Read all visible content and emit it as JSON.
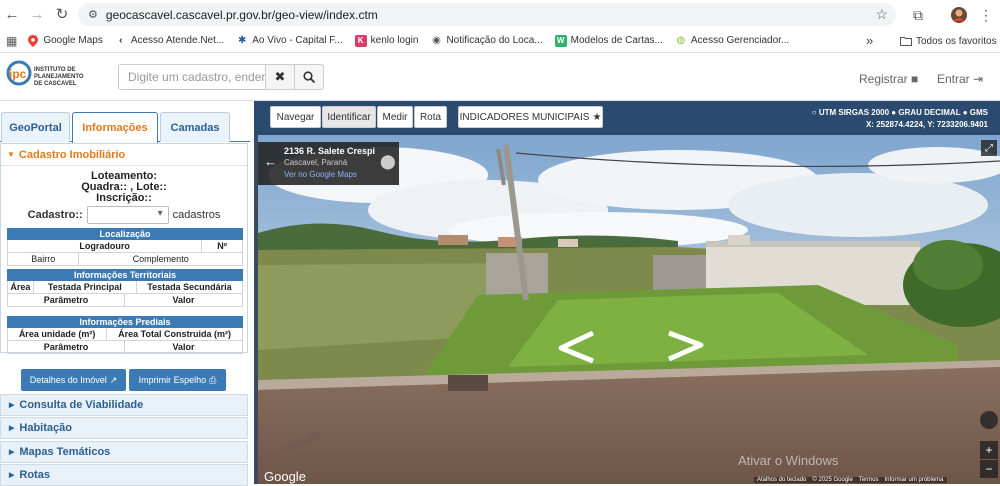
{
  "browser": {
    "url": "geocascavel.cascavel.pr.gov.br/geo-view/index.ctm",
    "bookmarks": [
      {
        "label": "Google Maps",
        "icon": "maps-pin-icon",
        "color": "#e94235"
      },
      {
        "label": "Acesso Atende.Net...",
        "icon": "chevron-left-icon",
        "color": "#444444"
      },
      {
        "label": "Ao Vivo - Capital F...",
        "icon": "paw-icon",
        "color": "#1e5aa8"
      },
      {
        "label": "kenlo login",
        "icon": "kenlo-icon",
        "color": "#d93b6a"
      },
      {
        "label": "Notificação do Loca...",
        "icon": "globe-icon",
        "color": "#555555"
      },
      {
        "label": "Modelos de Cartas...",
        "icon": "w-icon",
        "color": "#2fb36b"
      },
      {
        "label": "Acesso Gerenciador...",
        "icon": "leaf-icon",
        "color": "#8bbf2f"
      }
    ],
    "more_label": "»",
    "all_bookmarks_label": "Todos os favoritos"
  },
  "header": {
    "logo_text_line1": "INSTITUTO DE",
    "logo_text_line2": "PLANEJAMENTO",
    "logo_text_line3": "DE CASCAVEL",
    "search_placeholder": "Digite um cadastro, endere",
    "register_label": "Registrar",
    "login_label": "Entrar"
  },
  "sidebar": {
    "tabs": [
      {
        "label": "GeoPortal",
        "active": false
      },
      {
        "label": "Informações",
        "active": true
      },
      {
        "label": "Camadas",
        "active": false
      }
    ],
    "section_title": "Cadastro Imobiliário",
    "loteamento": "Loteamento:",
    "quadra_lote": "Quadra:: , Lote::",
    "inscricao": "Inscrição::",
    "cadastro_label": "Cadastro::",
    "cadastros_label": "cadastros",
    "localizacao": {
      "title": "Localização",
      "logradouro": "Logradouro",
      "numero": "Nº",
      "bairro": "Bairro",
      "complemento": "Complemento"
    },
    "territoriais": {
      "title": "Informações Territoriais",
      "area": "Área",
      "testada_principal": "Testada Principal",
      "testada_secundaria": "Testada Secundária",
      "parametro": "Parâmetro",
      "valor": "Valor"
    },
    "prediais": {
      "title": "Informações Prediais",
      "area_unidade": "Área unidade (m²)",
      "area_total": "Área Total Construida (m²)",
      "parametro": "Parâmetro",
      "valor": "Valor"
    },
    "btn_detalhes": "Detalhes do Imóvel",
    "btn_imprimir": "Imprimir Espelho",
    "menu": [
      "Consulta de Viabilidade",
      "Habitação",
      "Mapas Temáticos",
      "Rotas"
    ]
  },
  "map": {
    "toolbar": [
      "Navegar",
      "Identificar",
      "Medir",
      "Rota"
    ],
    "active_tool": "Identificar",
    "indicadores_label": "INDICADORES MUNICIPAIS",
    "coord_options": [
      "UTM SIRGAS 2000",
      "GRAU DECIMAL",
      "GMS"
    ],
    "coord_readout": "X: 252874.4224, Y: 7233206.9401",
    "streetview": {
      "address": "2136 R. Salete Crespi",
      "city": "Cascavel, Paraná",
      "link": "Ver no Google Maps",
      "google_label": "Google",
      "watermark_title": "Ativar o Windows",
      "footer_items": [
        "Atalhos do teclado",
        "© 2025 Google",
        "Termos",
        "Informar um problema"
      ]
    }
  },
  "colors": {
    "brand_blue": "#3c7ab5",
    "accent_orange": "#e07b1d",
    "toolbar_dark": "#2b4a6f"
  }
}
